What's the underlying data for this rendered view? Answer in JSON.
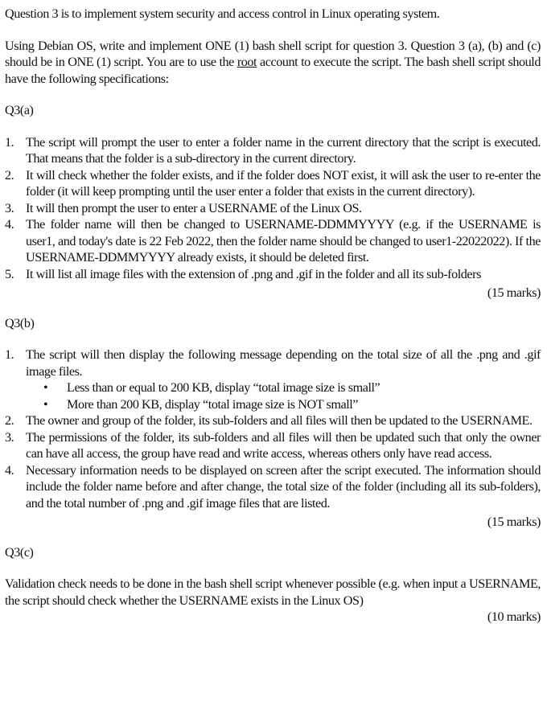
{
  "intro": "Question 3 is to implement system security and access control in Linux operating system.",
  "spec": {
    "before_root": "Using Debian OS, write and implement ONE (1) bash shell script for question 3. Question 3 (a), (b) and (c) should be in ONE (1) script. You are to use the ",
    "root_word": "root",
    "after_root": " account to execute the script. The bash shell script should have the following specifications:"
  },
  "sections": {
    "a": {
      "heading": "Q3(a)",
      "items": [
        {
          "num": "1.",
          "text": "The script will prompt the user to enter a folder name in the current directory that the script is executed. That means that the folder is a sub-directory in the current directory."
        },
        {
          "num": "2.",
          "text": "It will check whether the folder exists, and if the folder does NOT exist, it will ask the user to re-enter the folder (it will keep prompting until the user enter a folder that exists in the current directory)."
        },
        {
          "num": "3.",
          "text": "It will then prompt the user to enter a USERNAME of the Linux OS."
        },
        {
          "num": "4.",
          "text": "The folder name will then be changed to USERNAME-DDMMYYYY (e.g. if the USERNAME is user1, and today's date is 22 Feb 2022, then the folder name should be changed to user1-22022022). If the USERNAME-DDMMYYYY already exists, it should be deleted first."
        },
        {
          "num": "5.",
          "text": "It will list all image files with the extension of .png and .gif in the folder and all its sub-folders"
        }
      ],
      "marks": "(15 marks)"
    },
    "b": {
      "heading": "Q3(b)",
      "items": [
        {
          "num": "1.",
          "text": "The script will then display the following message depending on the total size of all the .png and .gif image files."
        },
        {
          "num": "2.",
          "text": "The owner and group of the folder, its sub-folders and all files will then be updated to the USERNAME."
        },
        {
          "num": "3.",
          "text": "The permissions of the folder, its sub-folders and all files will then be updated such that only the owner can have all access, the group have read and write access, whereas others only have read access."
        },
        {
          "num": "4.",
          "text": "Necessary information needs to be displayed on screen after the script executed. The information should include the folder name before and after change, the total size of the folder (including all its sub-folders), and the total number of .png and .gif image files that are listed."
        }
      ],
      "bullets": [
        "Less than or equal to 200 KB, display “total image size is small”",
        "More than 200 KB, display “total image size is NOT small”"
      ],
      "marks": "(15 marks)"
    },
    "c": {
      "heading": "Q3(c)",
      "text": "Validation check needs to be done in the bash shell script whenever possible (e.g. when input a USERNAME, the script should check whether the USERNAME exists in the Linux OS)",
      "marks": "(10 marks)"
    }
  },
  "bullet_glyph": "•"
}
